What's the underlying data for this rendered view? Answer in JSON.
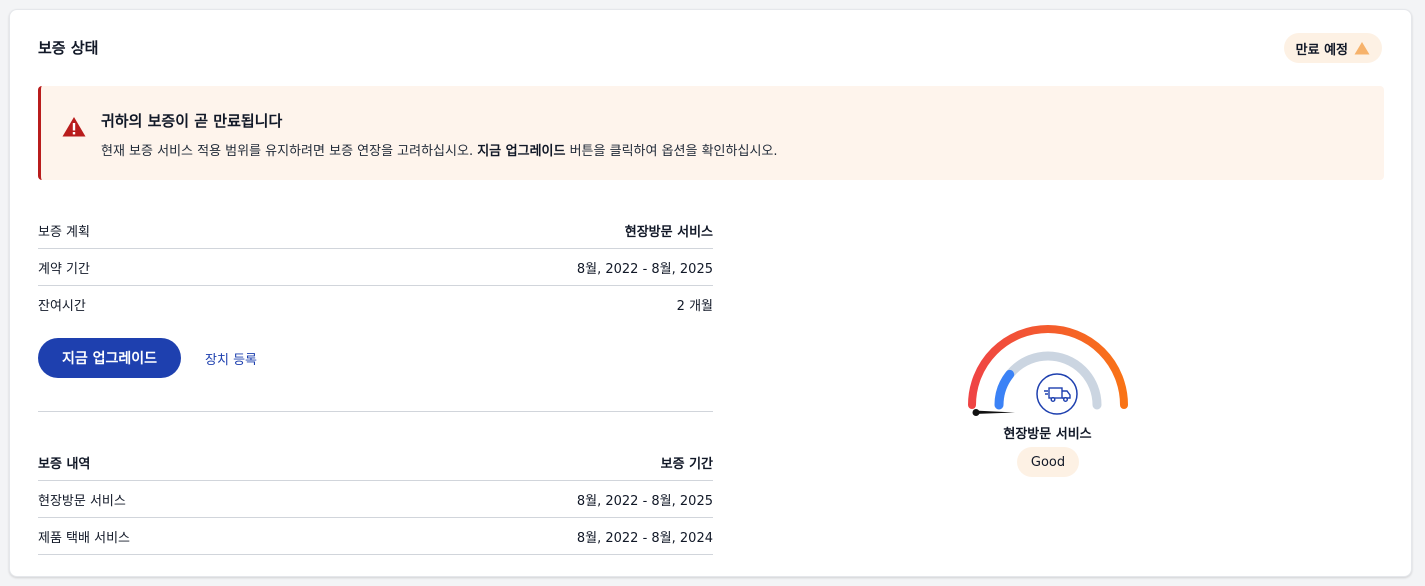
{
  "card": {
    "title": "보증 상태",
    "status_badge": "만료 예정"
  },
  "alert": {
    "title": "귀하의 보증이 곧 만료됩니다",
    "body_before": "현재 보증 서비스 적용 범위를 유지하려면 보증 연장을 고려하십시오. ",
    "body_bold": "지금 업그레이드",
    "body_after": " 버튼을 클릭하여 옵션을 확인하십시오."
  },
  "plan": {
    "rows": [
      {
        "label": "보증 계획",
        "value": "현장방문 서비스"
      },
      {
        "label": "계약 기간",
        "value": "8월, 2022 - 8월, 2025"
      },
      {
        "label": "잔여시간",
        "value": "2 개월"
      }
    ]
  },
  "actions": {
    "upgrade_label": "지금 업그레이드",
    "register_label": "장치 등록"
  },
  "history": {
    "header_left": "보증 내역",
    "header_right": "보증 기간",
    "rows": [
      {
        "label": "현장방문 서비스",
        "value": "8월, 2022 - 8월, 2025"
      },
      {
        "label": "제품 택배 서비스",
        "value": "8월, 2022 - 8월, 2024"
      }
    ]
  },
  "gauge": {
    "label": "현장방문 서비스",
    "rating": "Good",
    "icon": "delivery-truck-icon",
    "level": 0.02
  },
  "colors": {
    "accent": "#1e40af",
    "alert_border": "#b91c1c",
    "badge_triangle": "#f6b26b"
  }
}
